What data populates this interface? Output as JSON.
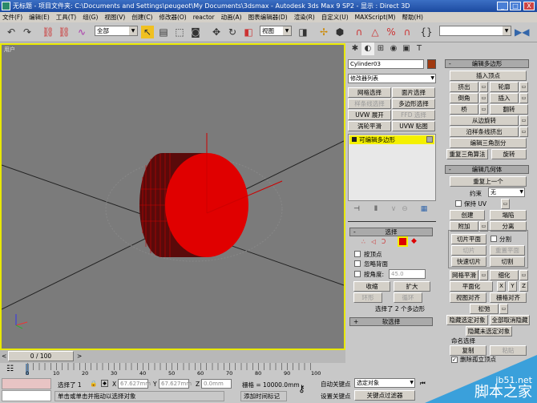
{
  "title": {
    "text": "无标题  - 项目文件夹: C:\\Documents and Settings\\peugeot\\My Documents\\3dsmax   - Autodesk 3ds Max 9 SP2   - 显示 : Direct 3D",
    "min": "_",
    "max": "□",
    "close": "X"
  },
  "menu": [
    "文件(F)",
    "编辑(E)",
    "工具(T)",
    "组(G)",
    "视图(V)",
    "创建(C)",
    "修改器(O)",
    "reactor",
    "动画(A)",
    "图表编辑器(D)",
    "渲染(R)",
    "自定义(U)",
    "MAXScript(M)",
    "帮助(H)"
  ],
  "toolbar": {
    "selection_filter": "全部",
    "ref_coord": "视图",
    "named_sel": ""
  },
  "viewport": {
    "label": "用户"
  },
  "panel": {
    "object_name": "Cylinder03",
    "object_color": "#a03a10",
    "modifier_list": "修改器列表",
    "mod_buttons": [
      "网格选择",
      "面片选择",
      "样条线选择",
      "多边形选择",
      "UVW 展开",
      "FFD 选择",
      "涡轮平滑",
      "UVW 贴图"
    ],
    "stack_item": "可编辑多边形",
    "selection": {
      "title": "选择",
      "by_vertex": "按顶点",
      "ignore_back": "忽略背面",
      "by_angle": "按角度:",
      "angle": "45.0",
      "shrink": "收缩",
      "grow": "扩大",
      "ring": "环形",
      "loop": "循环",
      "status": "选择了 2 个多边形"
    },
    "soft_sel": "软选择",
    "edit_poly": {
      "title": "编辑多边形",
      "insert_vertex": "插入顶点",
      "extrude": "挤出",
      "outline": "轮廓",
      "bevel": "倒角",
      "inset": "插入",
      "bridge": "桥",
      "flip": "翻转",
      "hinge": "从边旋转",
      "extrude_spline": "沿样条线挤出",
      "edit_tri": "编辑三角剖分",
      "retri": "重复三角算法",
      "turn": "旋转"
    },
    "edit_geom": {
      "title": "编辑几何体",
      "repeat": "重复上一个",
      "constraint_label": "约束",
      "constraint": "无",
      "preserve_uv": "保持 UV",
      "create": "创建",
      "collapse": "塌陷",
      "attach": "附加",
      "detach": "分离",
      "slice_plane": "切片平面",
      "split": "分割",
      "slice": "切片",
      "reset_plane": "重置平面",
      "quickslice": "快速切片",
      "cut": "切割",
      "meshsmooth": "网格平滑",
      "tessellate": "细化",
      "planar": "平面化",
      "x": "X",
      "y": "Y",
      "z": "Z",
      "view_align": "视图对齐",
      "grid_align": "栅格对齐",
      "relax": "松弛",
      "hide_sel": "隐藏选定对象",
      "unhide_all": "全部取消隐藏",
      "hide_unsel": "隐藏未选定对象",
      "named_sel": "命名选择",
      "copy": "复制",
      "paste": "粘贴",
      "delete_iso": "删除孤立顶点"
    }
  },
  "timeline": {
    "frame": "0 / 100",
    "ticks": [
      "0",
      "10",
      "20",
      "30",
      "40",
      "50",
      "60",
      "70",
      "80",
      "90",
      "100"
    ]
  },
  "status": {
    "selected": "选择了 1",
    "x": "67.627mm",
    "y": "67.627mm",
    "z": "0.0mm",
    "grid": "栅格 = 10000.0mm",
    "prompt": "单击或单击并拖动以选择对象",
    "add_tag": "添加时间标记",
    "auto_key": "自动关键点",
    "set_key": "设置关键点",
    "key_mode": "选定对象",
    "key_filters": "关键点过滤器"
  },
  "watermark": {
    "site": "jb51.net",
    "name": "脚本之家"
  }
}
